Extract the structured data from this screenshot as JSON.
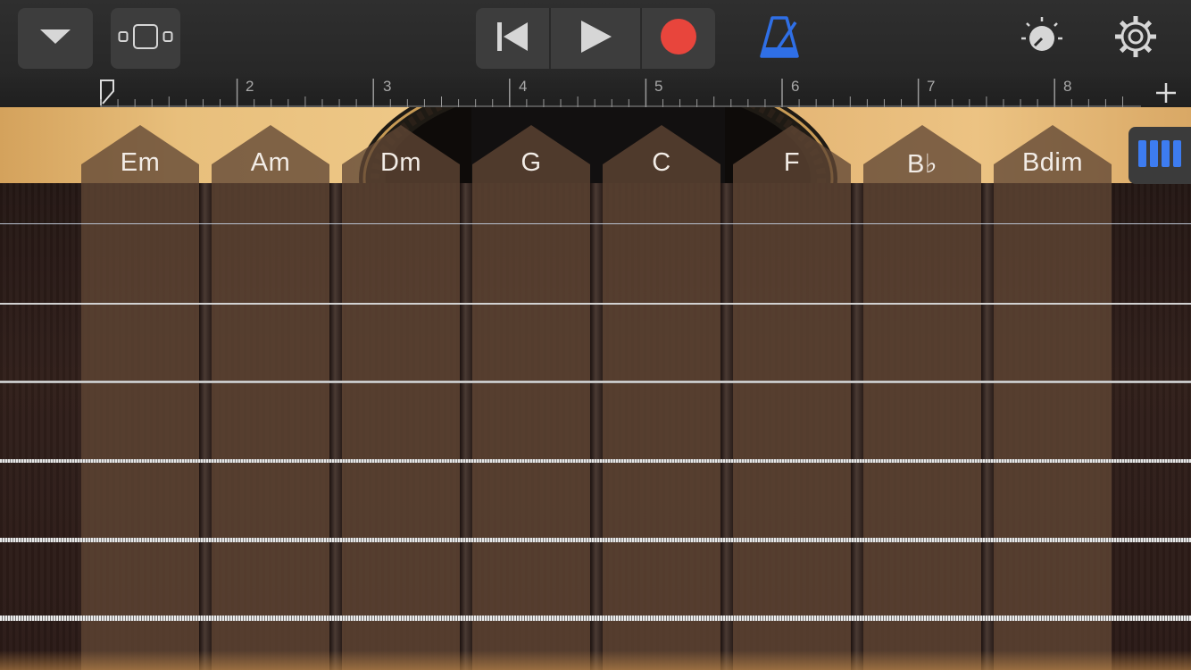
{
  "toolbar": {
    "browser_icon": "dropdown-triangle-icon",
    "tracks_icon": "tracks-view-icon",
    "transport": {
      "rewind_icon": "go-to-beginning-icon",
      "play_icon": "play-icon",
      "record_icon": "record-icon",
      "record_color": "#e8453c"
    },
    "metronome_icon": "metronome-icon",
    "metronome_color": "#2f6fe6",
    "master_icon": "master-effects-knob-icon",
    "settings_icon": "gear-icon"
  },
  "ruler": {
    "bars": [
      "2",
      "3",
      "4",
      "5",
      "6",
      "7",
      "8"
    ],
    "add_section_icon": "plus-icon"
  },
  "chords": [
    "Em",
    "Am",
    "Dm",
    "G",
    "C",
    "F",
    "B♭",
    "Bdim"
  ],
  "strings_count": 6,
  "notes_toggle_icon": "notes-mode-bars-icon",
  "notes_toggle_color": "#3d7cf0"
}
